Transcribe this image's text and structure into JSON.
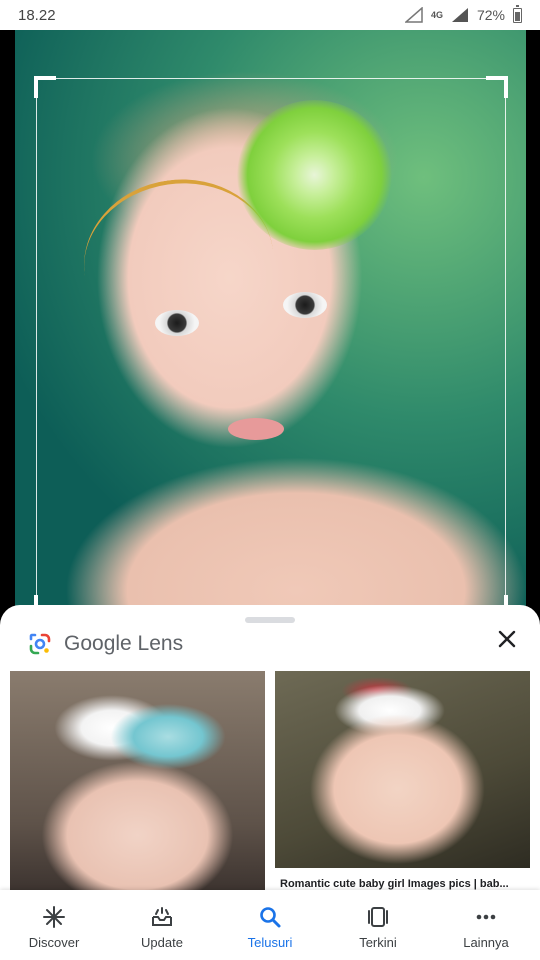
{
  "status_bar": {
    "time": "18.22",
    "network": "4G",
    "battery": "72%"
  },
  "lens": {
    "title": "Google Lens",
    "close_icon": "close-icon"
  },
  "results": [
    {
      "caption": ""
    },
    {
      "caption": "Romantic cute baby girl Images pics | bab..."
    }
  ],
  "nav": {
    "items": [
      {
        "label": "Discover",
        "icon": "asterisk-icon",
        "active": false
      },
      {
        "label": "Update",
        "icon": "inbox-update-icon",
        "active": false
      },
      {
        "label": "Telusuri",
        "icon": "search-icon",
        "active": true
      },
      {
        "label": "Terkini",
        "icon": "recent-tabs-icon",
        "active": false
      },
      {
        "label": "Lainnya",
        "icon": "more-icon",
        "active": false
      }
    ]
  },
  "colors": {
    "accent": "#1a73e8",
    "text_dark": "#202124",
    "text_muted": "#5f6368"
  }
}
